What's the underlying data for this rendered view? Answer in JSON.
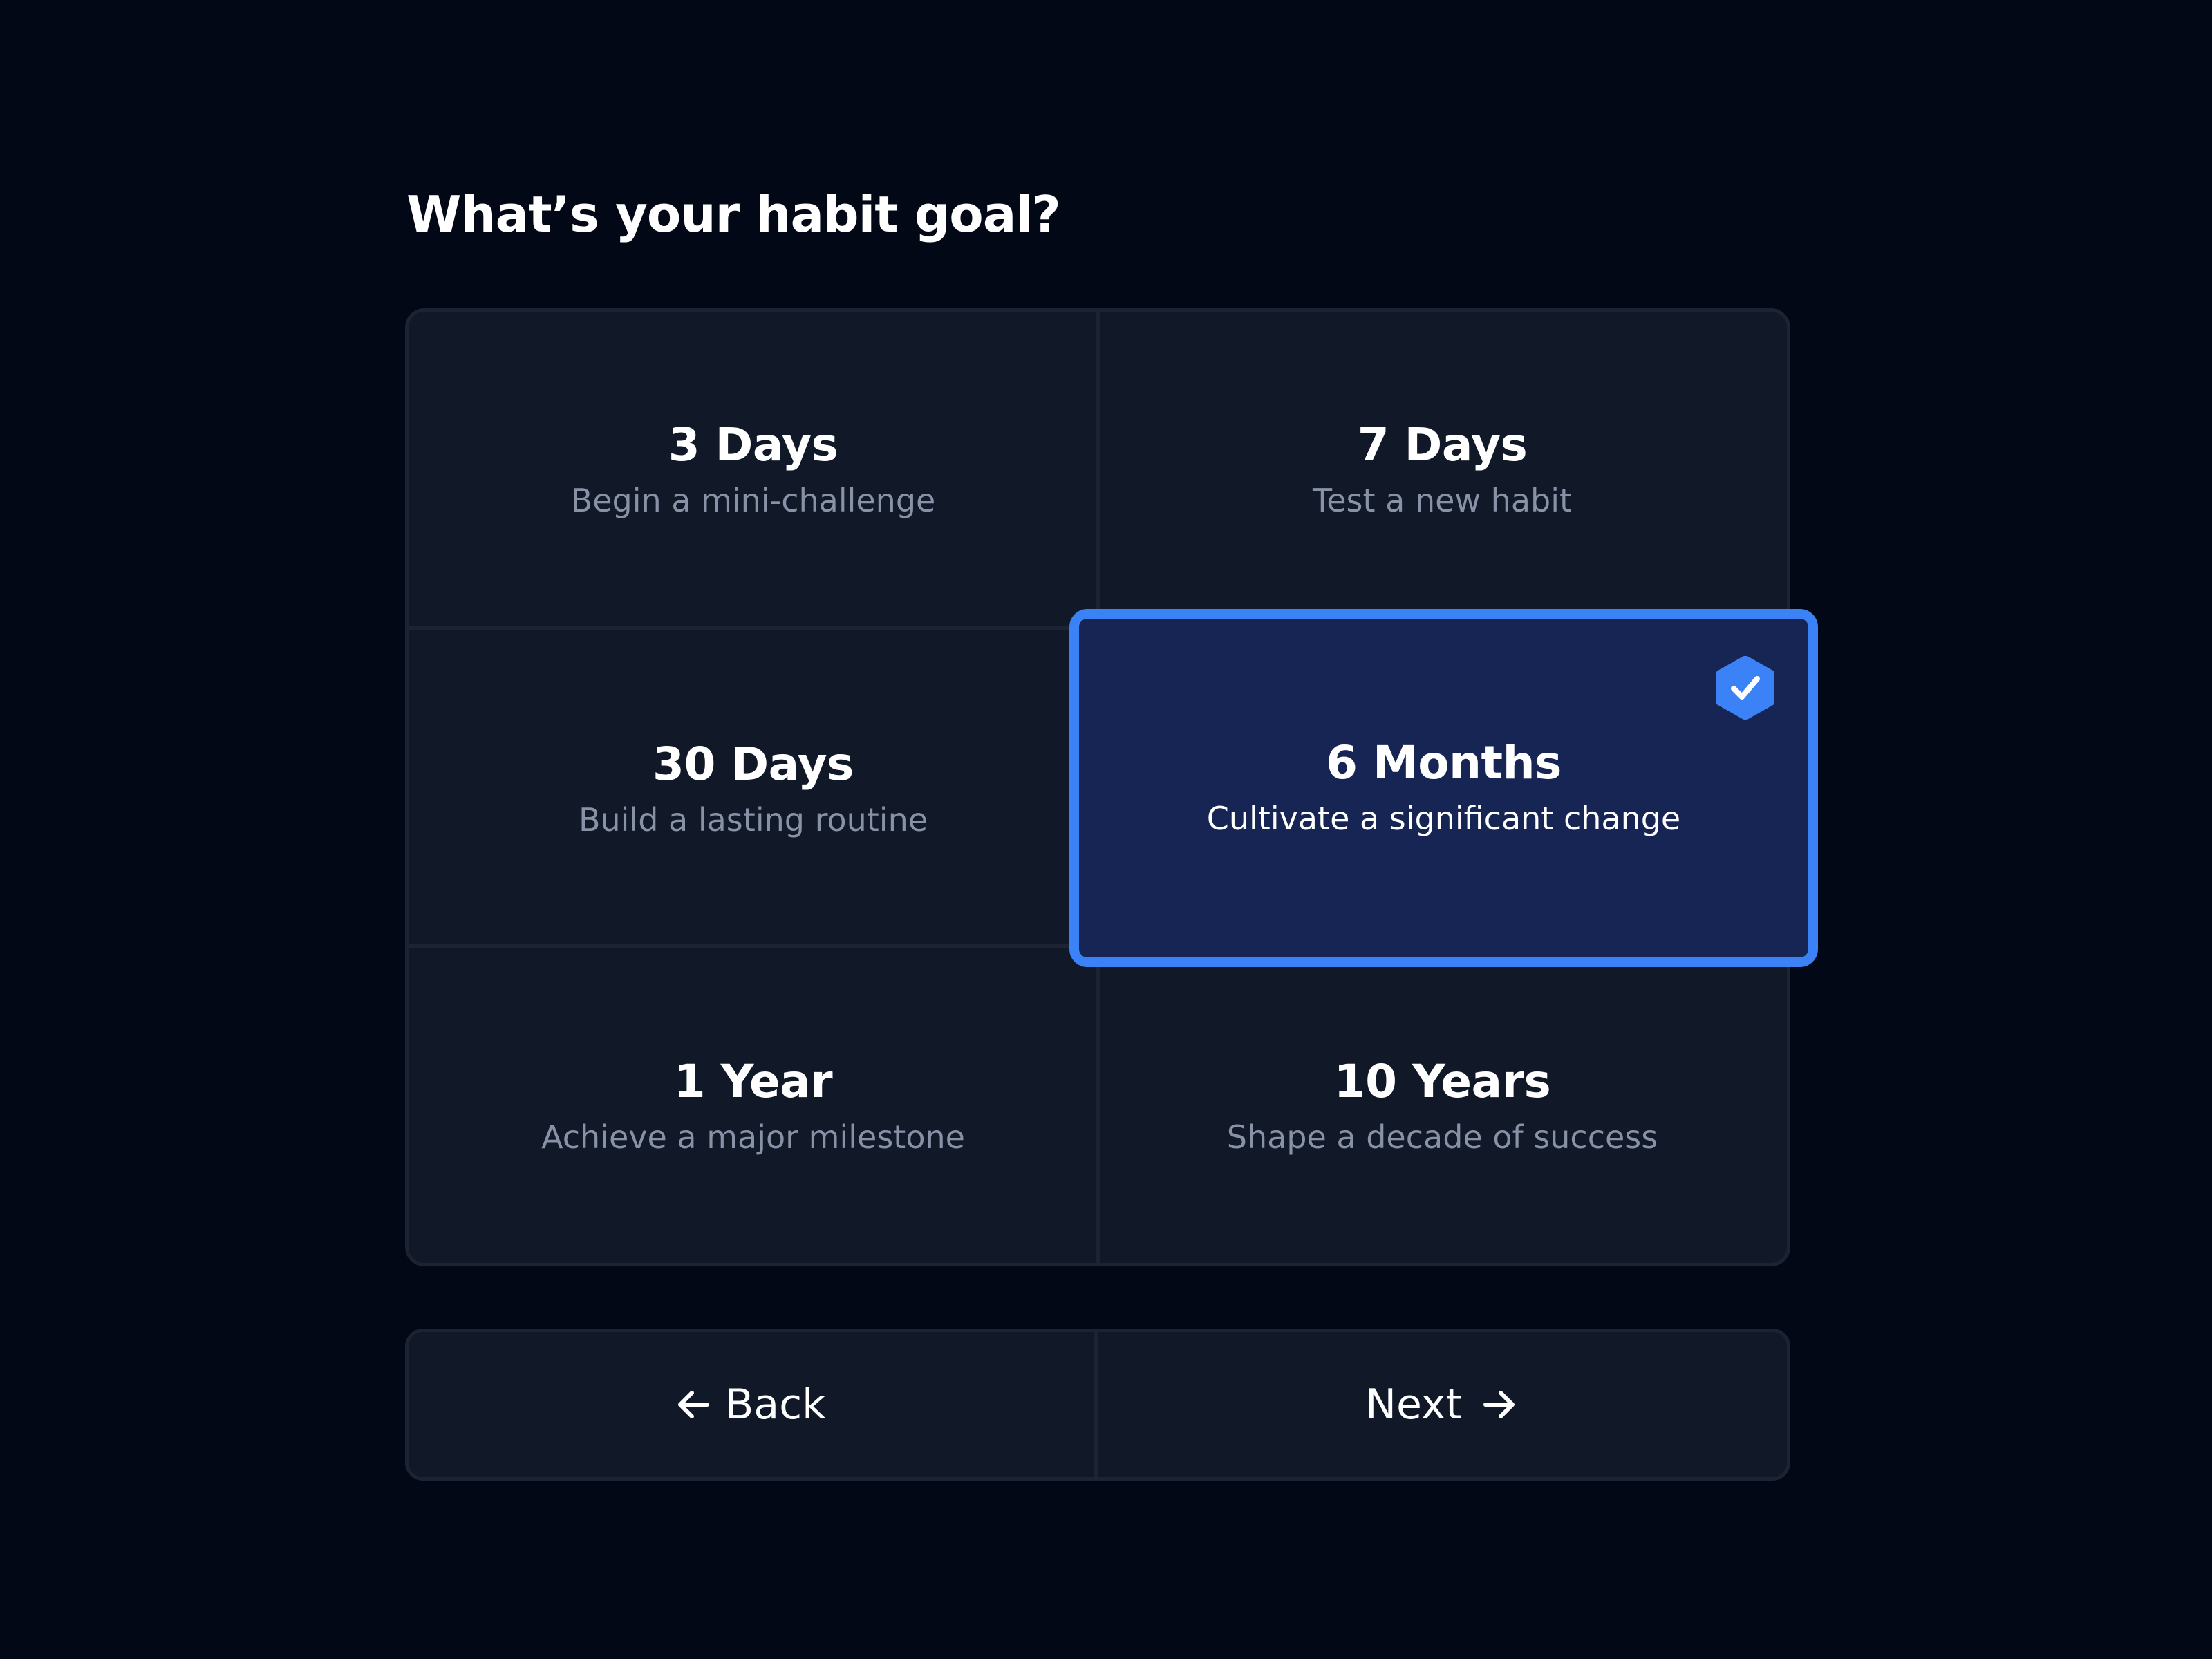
{
  "title": "What’s your habit goal?",
  "options": [
    {
      "title": "3 Days",
      "subtitle": "Begin a mini-challenge"
    },
    {
      "title": "7 Days",
      "subtitle": "Test a new habit"
    },
    {
      "title": "30 Days",
      "subtitle": "Build a lasting routine"
    },
    {
      "title": "6 Months",
      "subtitle": "Cultivate a significant change",
      "selected": true
    },
    {
      "title": "1 Year",
      "subtitle": "Achieve a major milestone"
    },
    {
      "title": "10 Years",
      "subtitle": "Shape a decade of success"
    }
  ],
  "nav": {
    "back_label": "Back",
    "back_icon": "arrow-left-icon",
    "next_label": "Next",
    "next_icon": "arrow-right-icon"
  },
  "colors": {
    "background": "#030816",
    "card": "#111828",
    "border": "#1c2434",
    "accent": "#3b82f6",
    "selected_fill": "#172554",
    "muted_text": "#8792a6"
  }
}
